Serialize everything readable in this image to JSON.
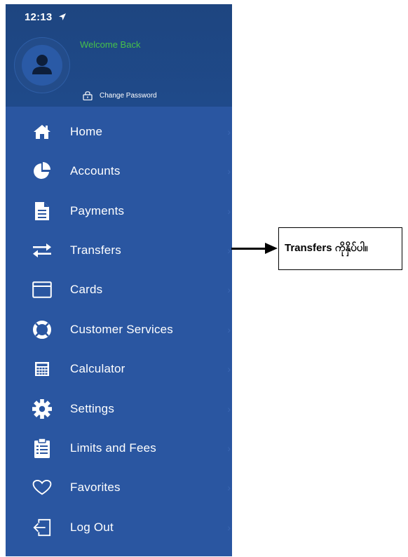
{
  "status": {
    "time": "12:13"
  },
  "profile": {
    "welcome": "Welcome Back",
    "change_password": "Change Password"
  },
  "menu": [
    {
      "label": "Home",
      "icon": "home-icon"
    },
    {
      "label": "Accounts",
      "icon": "pie-chart-icon"
    },
    {
      "label": "Payments",
      "icon": "document-icon"
    },
    {
      "label": "Transfers",
      "icon": "transfer-arrows-icon"
    },
    {
      "label": "Cards",
      "icon": "card-icon"
    },
    {
      "label": "Customer Services",
      "icon": "lifebuoy-icon"
    },
    {
      "label": "Calculator",
      "icon": "calculator-icon"
    },
    {
      "label": "Settings",
      "icon": "gear-icon"
    },
    {
      "label": "Limits and Fees",
      "icon": "clipboard-icon"
    },
    {
      "label": "Favorites",
      "icon": "heart-icon"
    },
    {
      "label": "Log Out",
      "icon": "logout-icon"
    }
  ],
  "annotation": {
    "text": "Transfers ကိုနှိပ်ပါ။"
  },
  "colors": {
    "menu_bg": "#2a56a1",
    "header_bg": "#1e4580",
    "welcome": "#46c04a"
  }
}
